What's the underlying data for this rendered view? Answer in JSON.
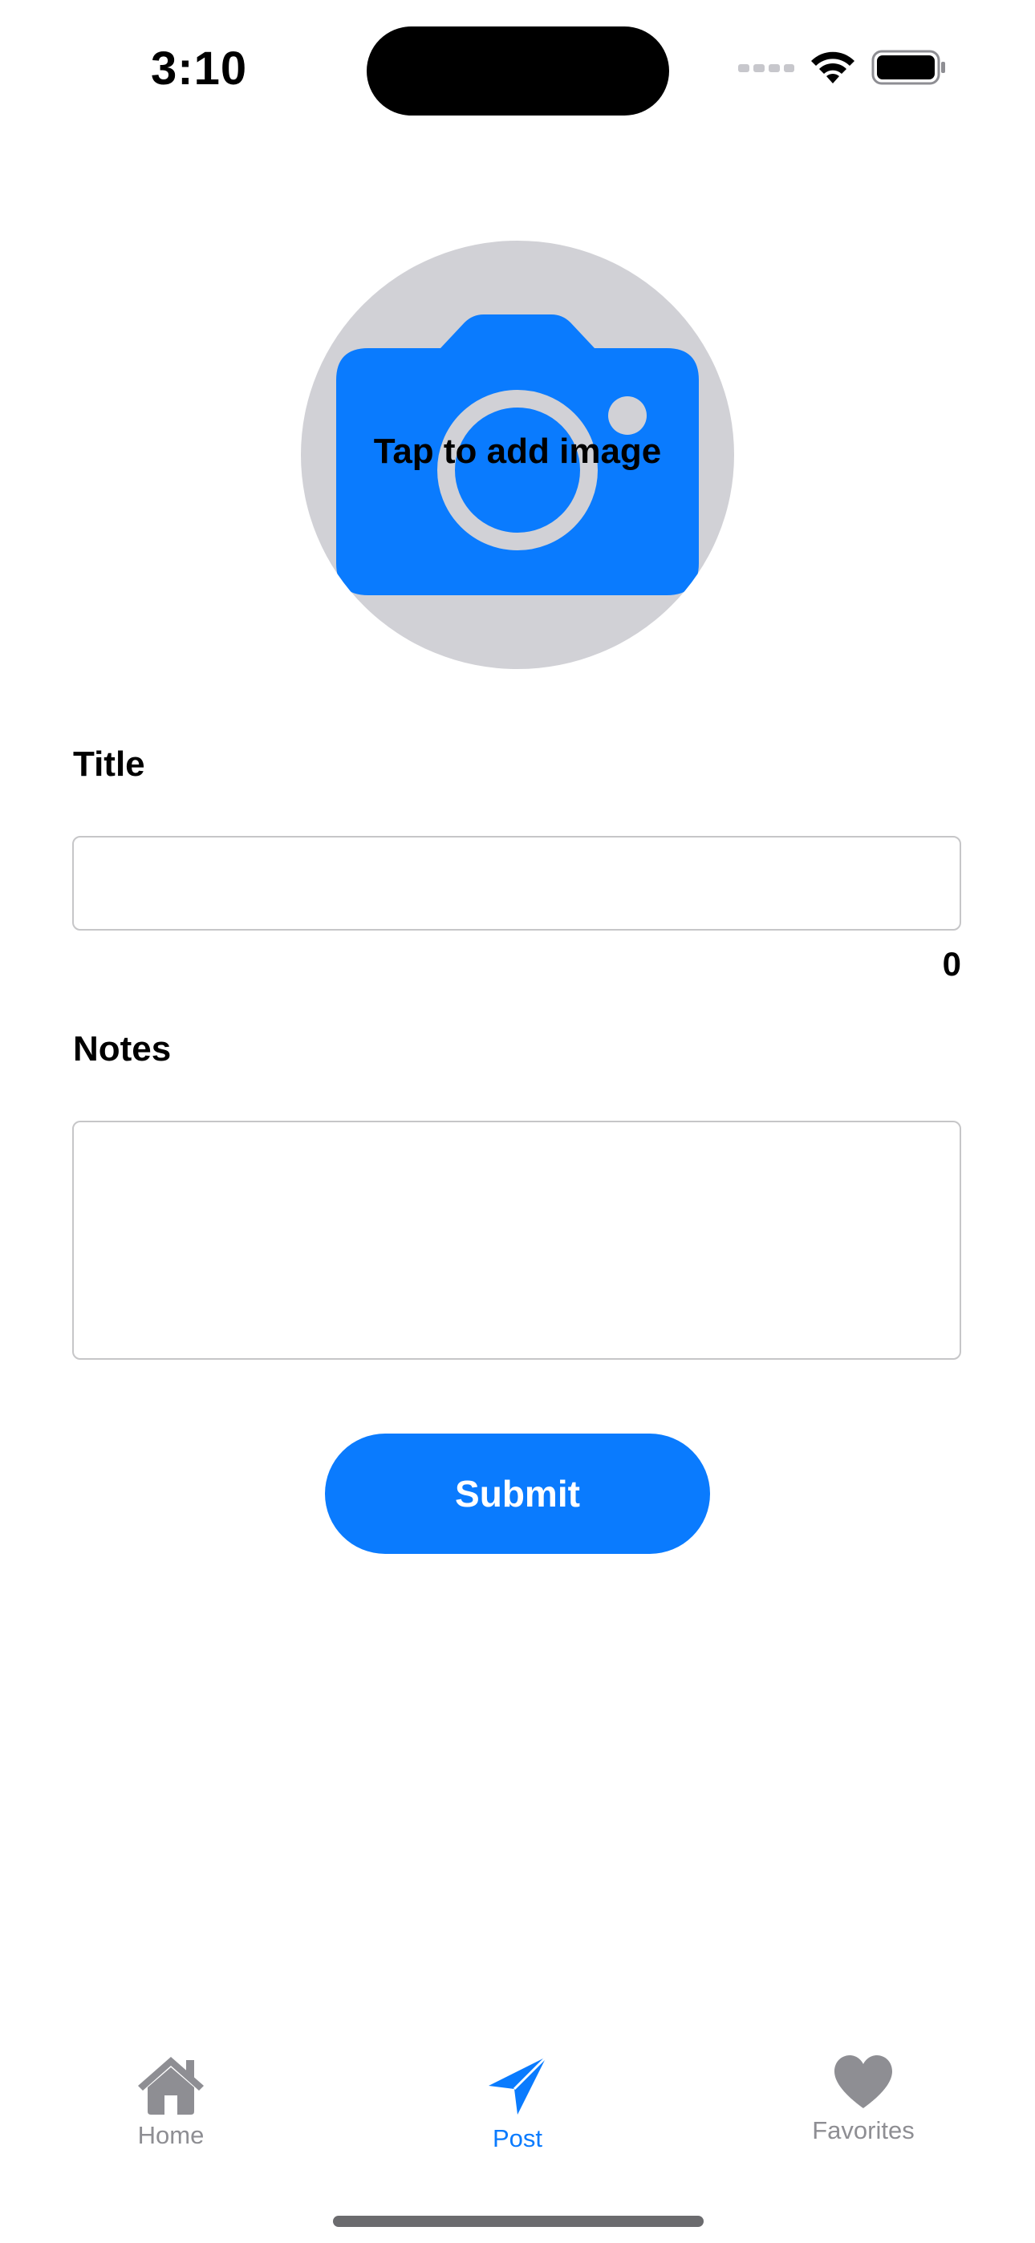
{
  "status_bar": {
    "time": "3:10"
  },
  "image_picker": {
    "label": "Tap to add image",
    "icon": "camera-icon"
  },
  "form": {
    "title_label": "Title",
    "title_value": "",
    "title_char_count": "0",
    "notes_label": "Notes",
    "notes_value": "",
    "submit_label": "Submit"
  },
  "tab_bar": {
    "tabs": [
      {
        "label": "Home",
        "icon": "house-icon",
        "active": false
      },
      {
        "label": "Post",
        "icon": "paper-plane-icon",
        "active": true
      },
      {
        "label": "Favorites",
        "icon": "heart-icon",
        "active": false
      }
    ]
  },
  "colors": {
    "accent": "#0a7bfe",
    "inactive": "#8e8e93",
    "picker_background": "#d1d1d6"
  }
}
